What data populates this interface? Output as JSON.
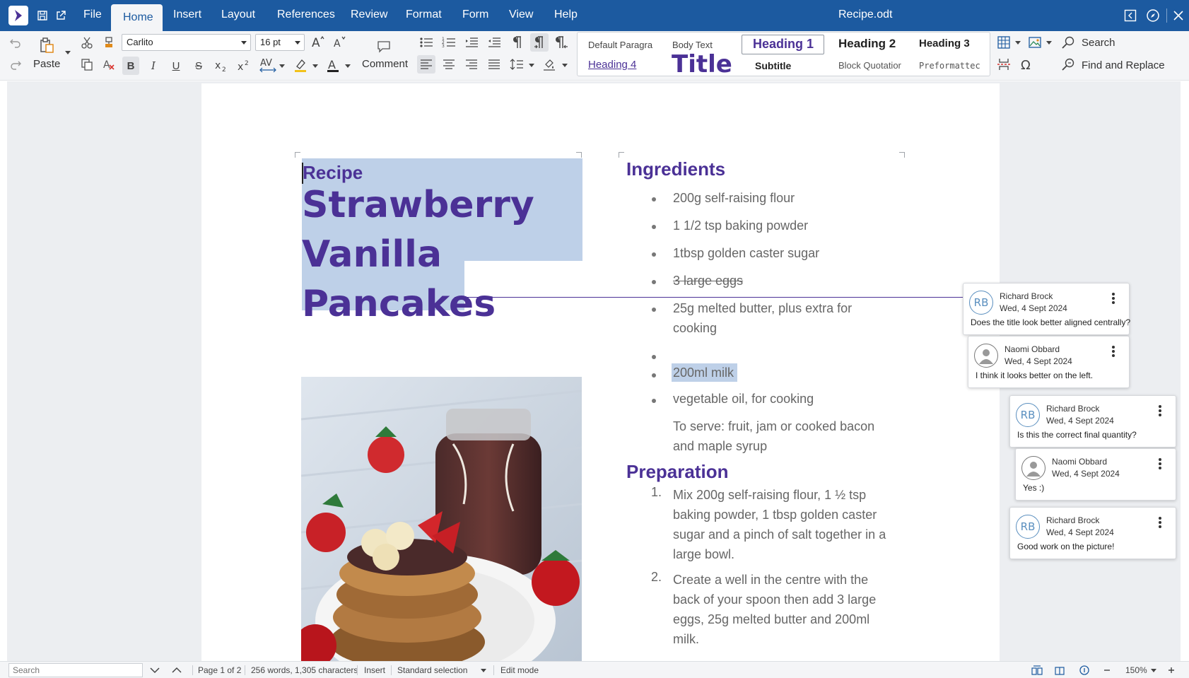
{
  "window": {
    "doc_title": "Recipe.odt"
  },
  "menu": {
    "file": "File",
    "home": "Home",
    "insert": "Insert",
    "layout": "Layout",
    "references": "References",
    "review": "Review",
    "format": "Format",
    "form": "Form",
    "view": "View",
    "help": "Help"
  },
  "ribbon": {
    "paste_label": "Paste",
    "font_name": "Carlito",
    "font_size": "16 pt",
    "comment_label": "Comment",
    "search_label": "Search",
    "find_replace_label": "Find and Replace",
    "styles": {
      "default_paragraph": "Default Paragra",
      "body_text": "Body Text",
      "heading1": "Heading 1",
      "heading2": "Heading 2",
      "heading3": "Heading 3",
      "heading4": "Heading 4",
      "title": "Title",
      "subtitle": "Subtitle",
      "block_quotation": "Block Quotatior",
      "preformatted": "Preformattec"
    }
  },
  "document": {
    "recipe_label": "Recipe",
    "title_lines": [
      "Strawberry",
      "Vanilla",
      "Pancakes"
    ],
    "ingredients_heading": "Ingredients",
    "ingredients": [
      "200g self-raising flour",
      "1 1/2 tsp baking powder",
      "1tbsp golden caster sugar",
      "3 large eggs",
      "25g melted butter, plus extra for",
      "cooking",
      "200ml milk",
      "vegetable oil, for cooking",
      "To serve: fruit, jam or cooked bacon",
      "and maple syrup"
    ],
    "preparation_heading": "Preparation",
    "steps": [
      {
        "num": "1.",
        "lines": [
          "Mix 200g self-raising flour, 1 ½ tsp",
          "baking powder, 1 tbsp golden caster",
          "sugar and a pinch of salt together in a",
          "large bowl."
        ]
      },
      {
        "num": "2.",
        "lines": [
          "Create a well in the centre with the",
          "back of your spoon then add 3 large",
          "eggs, 25g melted butter and 200ml",
          "milk."
        ]
      }
    ]
  },
  "comments": [
    {
      "initials": "RB",
      "author": "Richard Brock",
      "date": "Wed, 4 Sept 2024",
      "text": "Does the title look better aligned centrally?"
    },
    {
      "initials": "",
      "author": "Naomi Obbard",
      "date": "Wed, 4 Sept 2024",
      "text": "I think it looks better on the left."
    },
    {
      "initials": "RB",
      "author": "Richard Brock",
      "date": "Wed, 4 Sept 2024",
      "text": "Is this the correct final quantity?"
    },
    {
      "initials": "",
      "author": "Naomi Obbard",
      "date": "Wed, 4 Sept 2024",
      "text": "Yes :)"
    },
    {
      "initials": "RB",
      "author": "Richard Brock",
      "date": "Wed, 4 Sept 2024",
      "text": "Good work on the picture!"
    }
  ],
  "status": {
    "search_placeholder": "Search",
    "page": "Page 1 of 2",
    "words": "256 words, 1,305 characters",
    "insert_mode": "Insert",
    "selection_mode": "Standard selection",
    "edit_mode": "Edit mode",
    "zoom": "150%"
  },
  "colors": {
    "brand": "#1c5aa0",
    "heading": "#4b3196",
    "selection": "#bed0e8"
  }
}
